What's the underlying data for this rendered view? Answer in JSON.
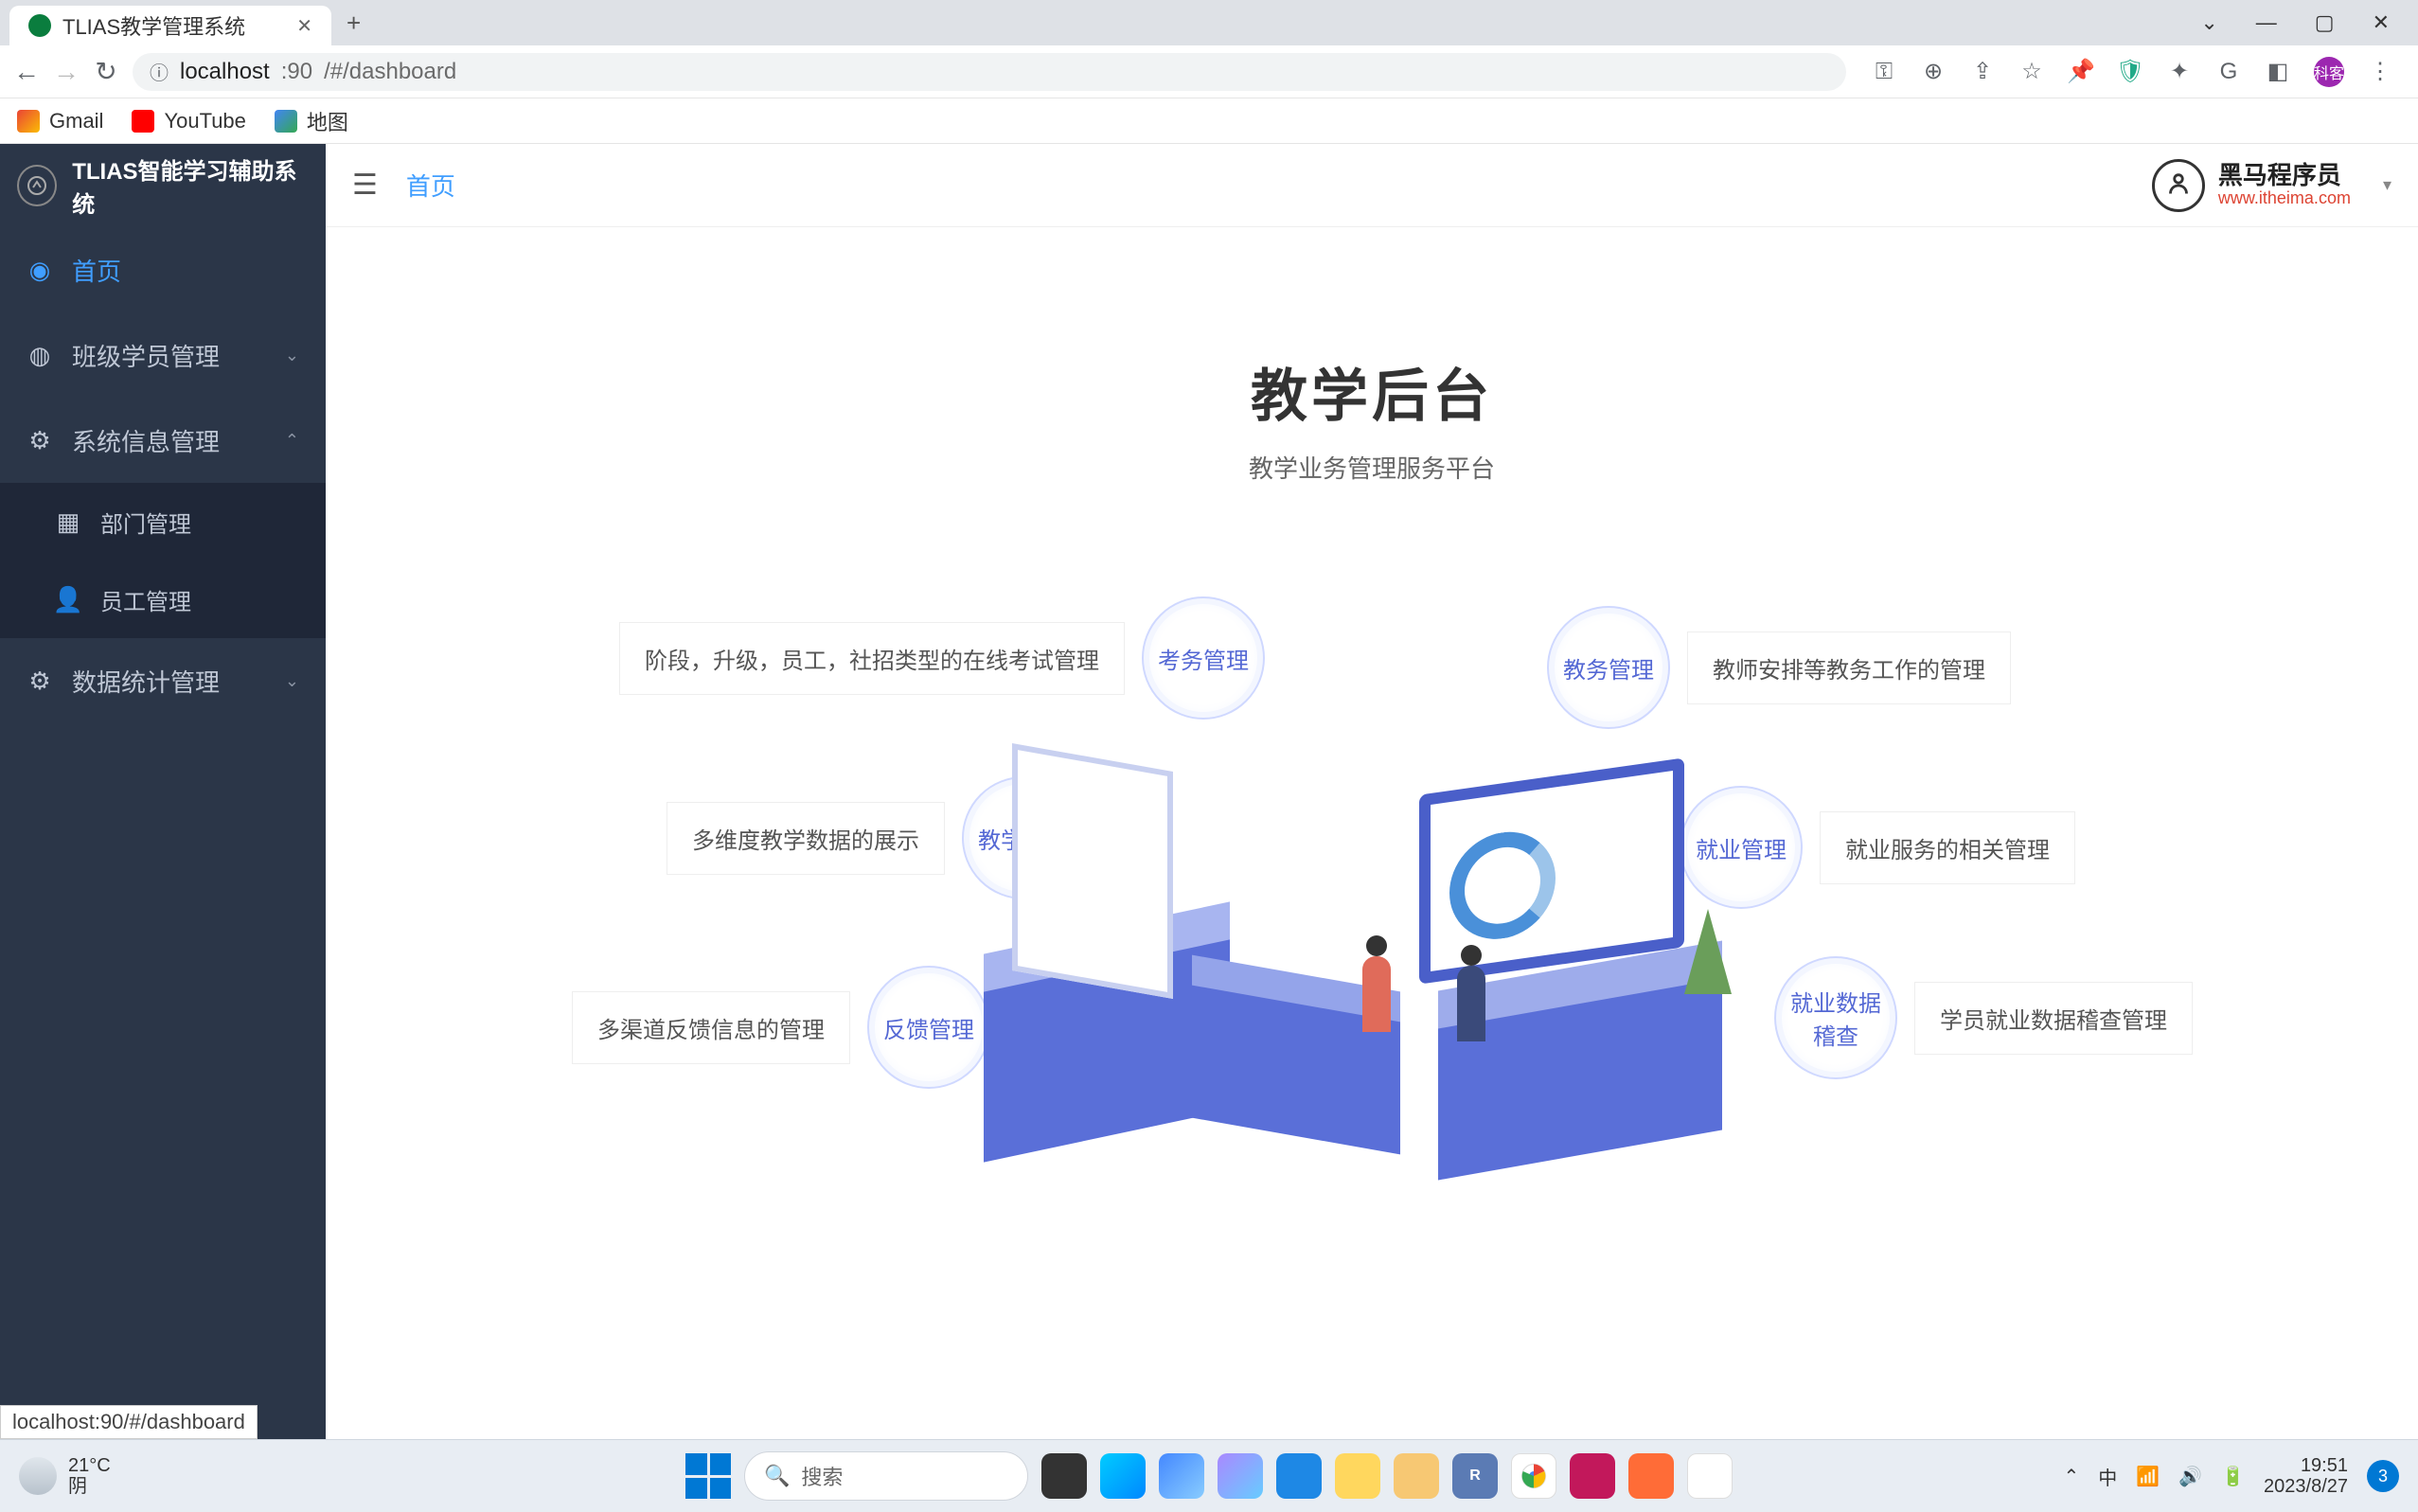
{
  "browser": {
    "tab_title": "TLIAS教学管理系统",
    "url_host": "localhost",
    "url_port": ":90",
    "url_path": "/#/dashboard",
    "window_controls": {
      "min": "—",
      "max": "▢",
      "close": "✕"
    },
    "nav": {
      "back": "←",
      "forward": "→",
      "reload": "↻"
    },
    "bookmarks": [
      {
        "label": "Gmail",
        "icon": "gmail"
      },
      {
        "label": "YouTube",
        "icon": "youtube"
      },
      {
        "label": "地图",
        "icon": "map"
      }
    ],
    "avatar_text": "科客",
    "status_hover": "localhost:90/#/dashboard"
  },
  "app": {
    "title": "TLIAS智能学习辅助系统",
    "menu": {
      "home": "首页",
      "class_mgmt": "班级学员管理",
      "sys_mgmt": "系统信息管理",
      "dept_mgmt": "部门管理",
      "emp_mgmt": "员工管理",
      "stats_mgmt": "数据统计管理"
    },
    "breadcrumb": "首页",
    "brand": {
      "cn": "黑马程序员",
      "url": "www.itheima.com"
    }
  },
  "hero": {
    "title": "教学后台",
    "subtitle": "教学业务管理服务平台"
  },
  "nodes": {
    "exam": {
      "bubble": "考务管理",
      "label": "阶段，升级，员工，社招类型的在线考试管理"
    },
    "teach_data": {
      "bubble": "教学数据",
      "label": "多维度教学数据的展示"
    },
    "feedback": {
      "bubble": "反馈管理",
      "label": "多渠道反馈信息的管理"
    },
    "edu_admin": {
      "bubble": "教务管理",
      "label": "教师安排等教务工作的管理"
    },
    "employment": {
      "bubble": "就业管理",
      "label": "就业服务的相关管理"
    },
    "emp_audit": {
      "bubble": "就业数据稽查",
      "label": "学员就业数据稽查管理"
    }
  },
  "taskbar": {
    "weather": {
      "temp": "21°C",
      "cond": "阴"
    },
    "search_placeholder": "搜索",
    "tray": {
      "ime": "中",
      "time": "19:51",
      "date": "2023/8/27",
      "badge": "3"
    }
  }
}
